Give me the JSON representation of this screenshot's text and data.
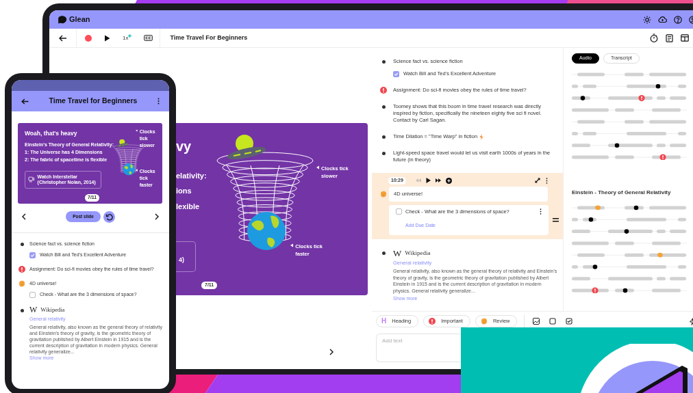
{
  "laptop": {
    "app_name": "Glean",
    "lecture_title": "Time Travel For Beginners",
    "speed": "1x",
    "slide": {
      "heading": "vy",
      "lines": [
        "elativity:",
        "ions",
        "lexible"
      ],
      "video_caption": "4)",
      "callouts": [
        "Clocks tick slower",
        "Clocks tick faster"
      ],
      "page": "7/11"
    },
    "notes": [
      {
        "kind": "bullet",
        "text": "Science fact vs. science fiction",
        "children": [
          {
            "kind": "task",
            "text": "Watch Bill and Ted's Excellent Adventure",
            "checked": true
          }
        ]
      },
      {
        "kind": "important",
        "text": "Assignment: Do sci-fi movies obey the rules of time travel?"
      },
      {
        "kind": "bullet",
        "text": "Toomey shows that this boom in time travel research was directly inspired by fiction, specifically the nineteen eighty five sci fi novel. Contact by Carl Sagan."
      },
      {
        "kind": "bullet",
        "text": "Time Dilation = \"Time Warp\" in fiction",
        "lightning": true
      },
      {
        "kind": "bullet",
        "text": "Light-speed space travel would let us visit earth 1000s of years in the future (in theory)"
      },
      {
        "kind": "review",
        "active": true,
        "timestamp": "10:29",
        "text": "4D universe!",
        "children": [
          {
            "kind": "task",
            "text": "Check - What are the 3 dimensions of space?",
            "checked": false,
            "action": "Add Due Date"
          }
        ]
      },
      {
        "kind": "wiki",
        "source_mark": "W",
        "source": "Wikipedia",
        "link": "General relativity",
        "text": "General relativity, also known as the general theory of relativity and Einstein's theory of gravity, is the geometric theory of gravitation published by Albert Einstein in 1915 and is the current description of gravitation in modern physics. General relativity generalize...",
        "more": "Show more"
      }
    ],
    "tags": [
      {
        "kind": "heading",
        "mark": "H",
        "label": "Heading"
      },
      {
        "kind": "important",
        "label": "Important"
      },
      {
        "kind": "review",
        "label": "Review"
      }
    ],
    "editor": {
      "placeholder": "Add text"
    },
    "panel": {
      "tabs": [
        {
          "label": "Audio",
          "selected": true
        },
        {
          "label": "Transcript",
          "selected": false
        }
      ],
      "section_title": "Einstein - Theory of General Relativity"
    }
  },
  "phone": {
    "title": "Time Travel for Beginners",
    "slide": {
      "heading": "Woah, that's heavy",
      "lines": [
        "Einstein's Theory of General Relativity:",
        "1: The Universe has 4 Dimensions",
        "2: The fabric of spacetime is flexible"
      ],
      "video_caption": "Watch Interstellar (Christopher Nolan, 2014)",
      "callouts": [
        "Clocks tick slower",
        "Clocks tick faster"
      ],
      "page": "7/11"
    },
    "post_button": "Post slide",
    "notes": [
      {
        "kind": "bullet",
        "text": "Science fact vs. science fiction",
        "children": [
          {
            "kind": "task",
            "text": "Watch Bill and Ted's Excellent Adventure",
            "checked": true
          }
        ]
      },
      {
        "kind": "important",
        "text": "Assignment: Do sci-fi movies obey the rules of time travel?"
      },
      {
        "kind": "review",
        "active": false,
        "text": "4D universe!",
        "children": [
          {
            "kind": "task",
            "text": "Check - What are the 3 dimensions of space?",
            "checked": false
          }
        ]
      },
      {
        "kind": "wiki",
        "source_mark": "W",
        "source": "Wikipedia",
        "link": "General relativity",
        "text": "General relativity, also known as the general theory of relativity and Einstein's theory of gravity, is the geometric theory of gravitation published by Albert Einstein in 1915 and is the current description of gravitation in modern physics. General relativity generalize...",
        "more": "Show more"
      }
    ]
  }
}
